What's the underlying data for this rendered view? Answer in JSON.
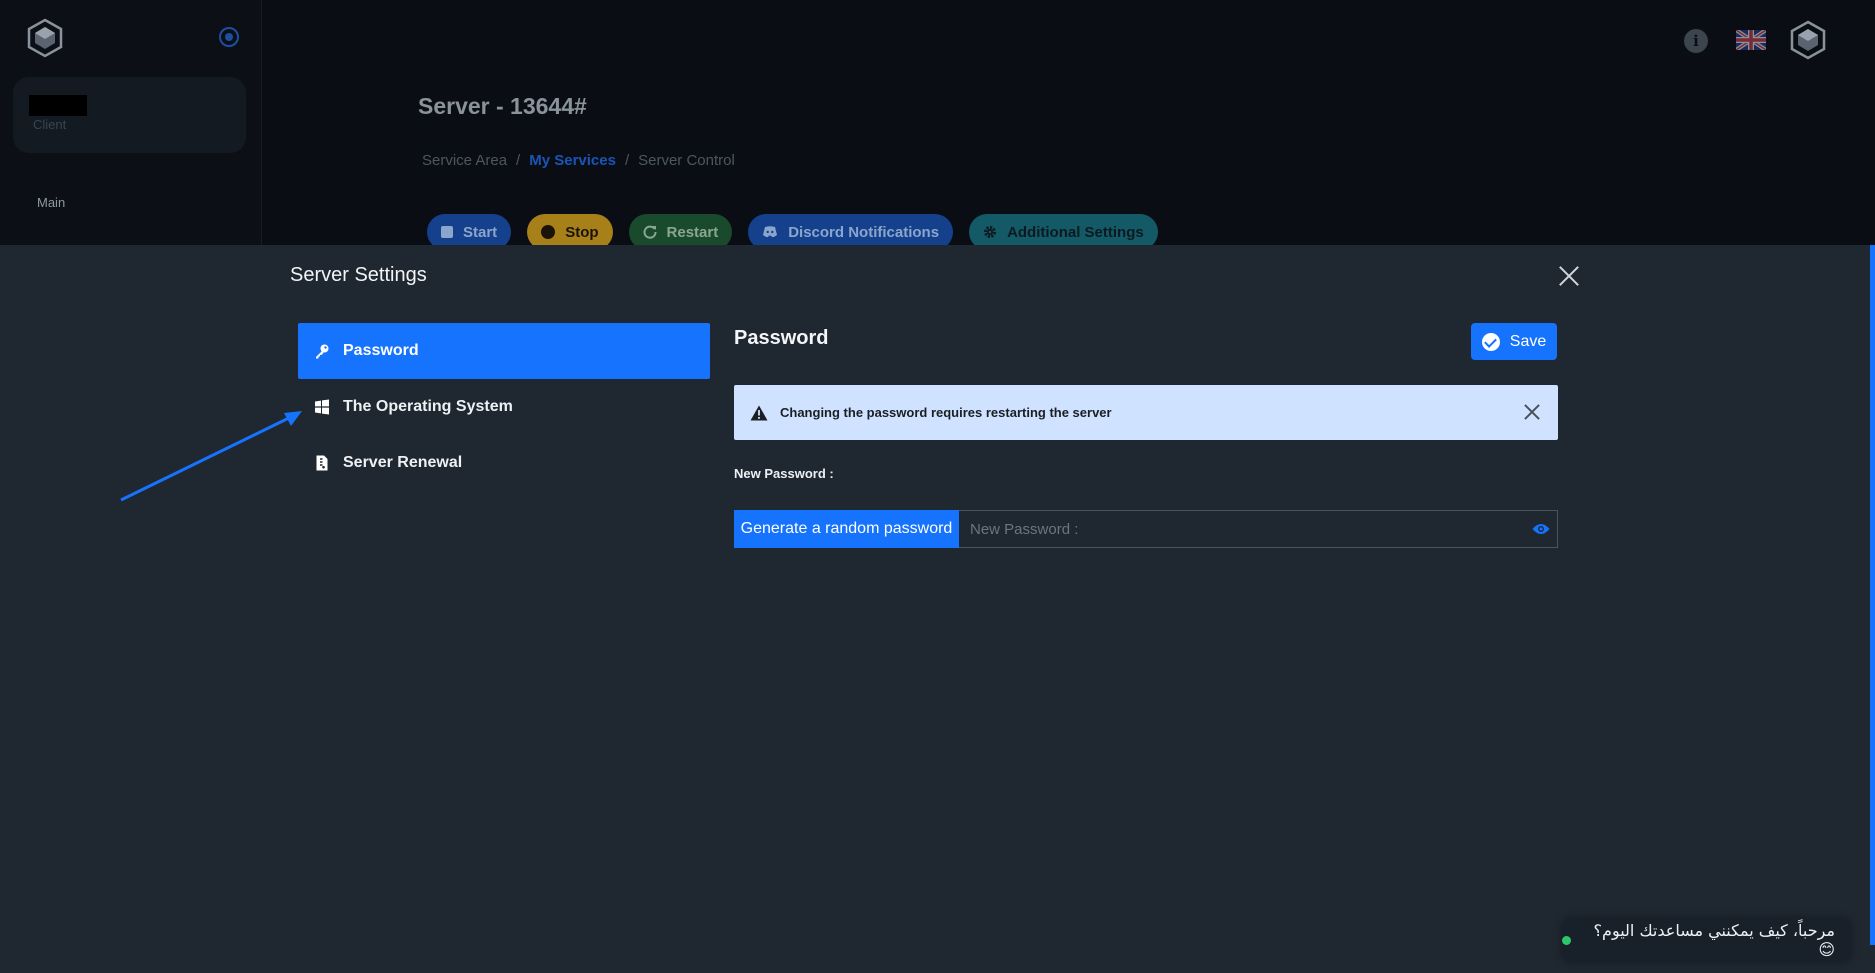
{
  "background": {
    "client_role": "Client",
    "nav_section": "Main",
    "page_title": "Server - 13644#",
    "breadcrumb": [
      "Service Area",
      "/",
      "My Services",
      "/",
      "Server Control"
    ],
    "actions": [
      {
        "label": "Start"
      },
      {
        "label": "Stop"
      },
      {
        "label": "Restart"
      },
      {
        "label": "Discord Notifications"
      },
      {
        "label": "Additional Settings"
      }
    ],
    "header_icons": [
      "info-icon",
      "uk-flag-icon",
      "avatar-logo-icon"
    ]
  },
  "modal": {
    "title": "Server Settings",
    "nav": [
      {
        "label": "Password",
        "icon": "key-icon",
        "active": true
      },
      {
        "label": "The Operating System",
        "icon": "windows-icon",
        "active": false
      },
      {
        "label": "Server Renewal",
        "icon": "document-icon",
        "active": false
      }
    ],
    "panel": {
      "title": "Password",
      "save_label": "Save",
      "alert_text": "Changing the password requires restarting the server",
      "field_label": "New Password :",
      "generate_label": "Generate a random password",
      "input_placeholder": "New Password :",
      "input_value": ""
    }
  },
  "chat": {
    "text": "مرحباً، كيف يمكنني مساعدتك اليوم؟ 😊"
  },
  "colors": {
    "accent": "#1673fd",
    "modal_bg": "#1f2730",
    "alert_bg": "#cfe2ff",
    "stop": "#a8801a",
    "restart": "#1a4a2c",
    "additional": "#135a66"
  }
}
